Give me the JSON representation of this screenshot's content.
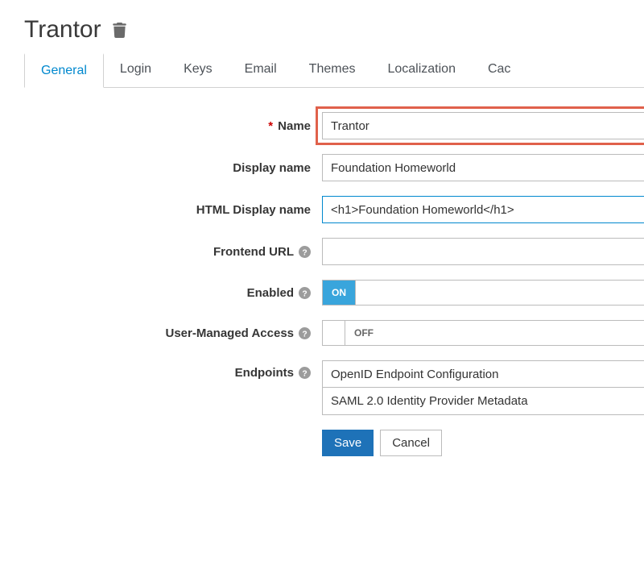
{
  "header": {
    "title": "Trantor"
  },
  "tabs": [
    {
      "label": "General",
      "active": true
    },
    {
      "label": "Login"
    },
    {
      "label": "Keys"
    },
    {
      "label": "Email"
    },
    {
      "label": "Themes"
    },
    {
      "label": "Localization"
    },
    {
      "label": "Cac"
    }
  ],
  "form": {
    "name": {
      "label": "Name",
      "value": "Trantor",
      "required": true
    },
    "displayName": {
      "label": "Display name",
      "value": "Foundation Homeworld"
    },
    "htmlDisplayName": {
      "label": "HTML Display name",
      "value": "<h1>Foundation Homeworld</h1>"
    },
    "frontendUrl": {
      "label": "Frontend URL",
      "value": ""
    },
    "enabled": {
      "label": "Enabled",
      "state": "ON"
    },
    "userManagedAccess": {
      "label": "User-Managed Access",
      "state": "OFF"
    },
    "endpoints": {
      "label": "Endpoints",
      "items": [
        "OpenID Endpoint Configuration",
        "SAML 2.0 Identity Provider Metadata"
      ]
    }
  },
  "buttons": {
    "save": "Save",
    "cancel": "Cancel"
  }
}
